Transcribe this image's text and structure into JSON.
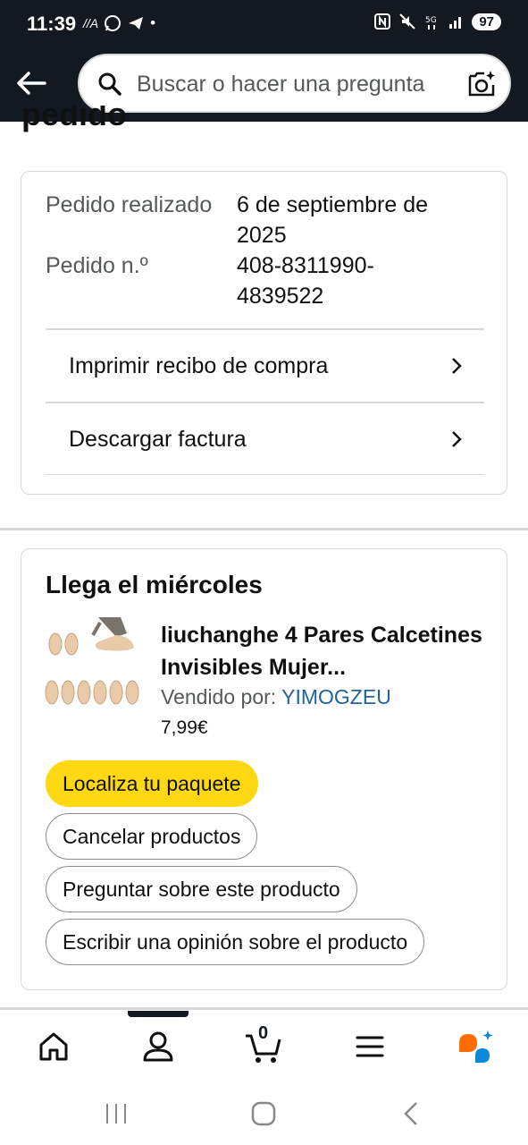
{
  "status_bar": {
    "time": "11:39",
    "left_icons": [
      "//A",
      "whatsapp-icon",
      "telegram-icon",
      "•"
    ],
    "battery": "97"
  },
  "header": {
    "search_placeholder": "Buscar o hacer una pregunta"
  },
  "page": {
    "partial_title": "pedido"
  },
  "order_info": {
    "placed_label": "Pedido realizado",
    "placed_value": "6 de septiembre de 2025",
    "number_label": "Pedido n.º",
    "number_value": "408-8311990-4839522",
    "links": [
      {
        "label": "Imprimir recibo de compra"
      },
      {
        "label": "Descargar factura"
      }
    ]
  },
  "delivery": {
    "title": "Llega el miércoles",
    "product_name": "liuchanghe 4 Pares Calcetines Invisibles Mujer...",
    "sold_by_label": "Vendido por: ",
    "seller": "YIMOGZEU",
    "price": "7,99€",
    "buttons": {
      "track": "Localiza tu paquete",
      "cancel": "Cancelar productos",
      "ask": "Preguntar sobre este producto",
      "review": "Escribir una opinión sobre el producto"
    }
  },
  "bottom_nav": {
    "cart_count": "0",
    "items": [
      "home-icon",
      "account-icon",
      "cart-icon",
      "menu-icon",
      "rufus-icon"
    ]
  },
  "colors": {
    "header_bg": "#131921",
    "primary_button": "#ffd814",
    "link": "#2162a1",
    "rufus_orange": "#ff6b00",
    "rufus_blue": "#0a8ad8"
  }
}
